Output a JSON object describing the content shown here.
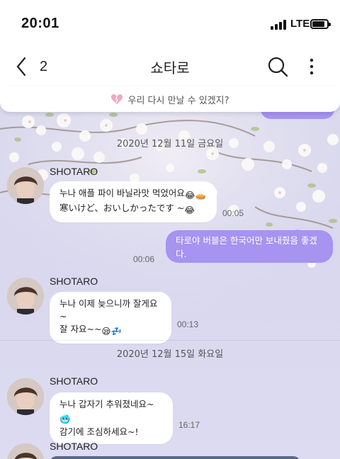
{
  "status_bar": {
    "time": "20:01",
    "network": "LTE"
  },
  "header": {
    "back_count": "2",
    "title": "쇼타로"
  },
  "notice": {
    "text": "우리 다시 만날 수 있겠지?"
  },
  "messages": [
    {
      "type": "date",
      "text": "2020년 12월 11일 금요일"
    },
    {
      "type": "incoming",
      "sender": "SHOTARO",
      "line1": "누나 애플 파이 바닐라맛 먹었어요",
      "line2": "寒いけど、おいしかったです ~",
      "time": "00:05"
    },
    {
      "type": "outgoing",
      "text": "타로야 버블은 한국어만 보내줬음 좋겠다.",
      "time": "00:06"
    },
    {
      "type": "incoming",
      "sender": "SHOTARO",
      "line1": "누나 이제 늦으니까 잘게요~",
      "line2": "잘 자요~~",
      "time": "00:13"
    },
    {
      "type": "date",
      "text": "2020년 12월 15일 화요일"
    },
    {
      "type": "incoming",
      "sender": "SHOTARO",
      "line1": "누나 갑자기 추워졌네요~",
      "line2": "감기에 조심하세요~!",
      "time": "16:17"
    },
    {
      "type": "incoming",
      "sender": "SHOTARO"
    }
  ],
  "colors": {
    "accent": "#a793f0",
    "chat_bg": "#d9d8ec"
  },
  "icons": [
    "chevron-left-icon",
    "search-icon",
    "more-vertical-icon",
    "broken-heart-icon"
  ]
}
